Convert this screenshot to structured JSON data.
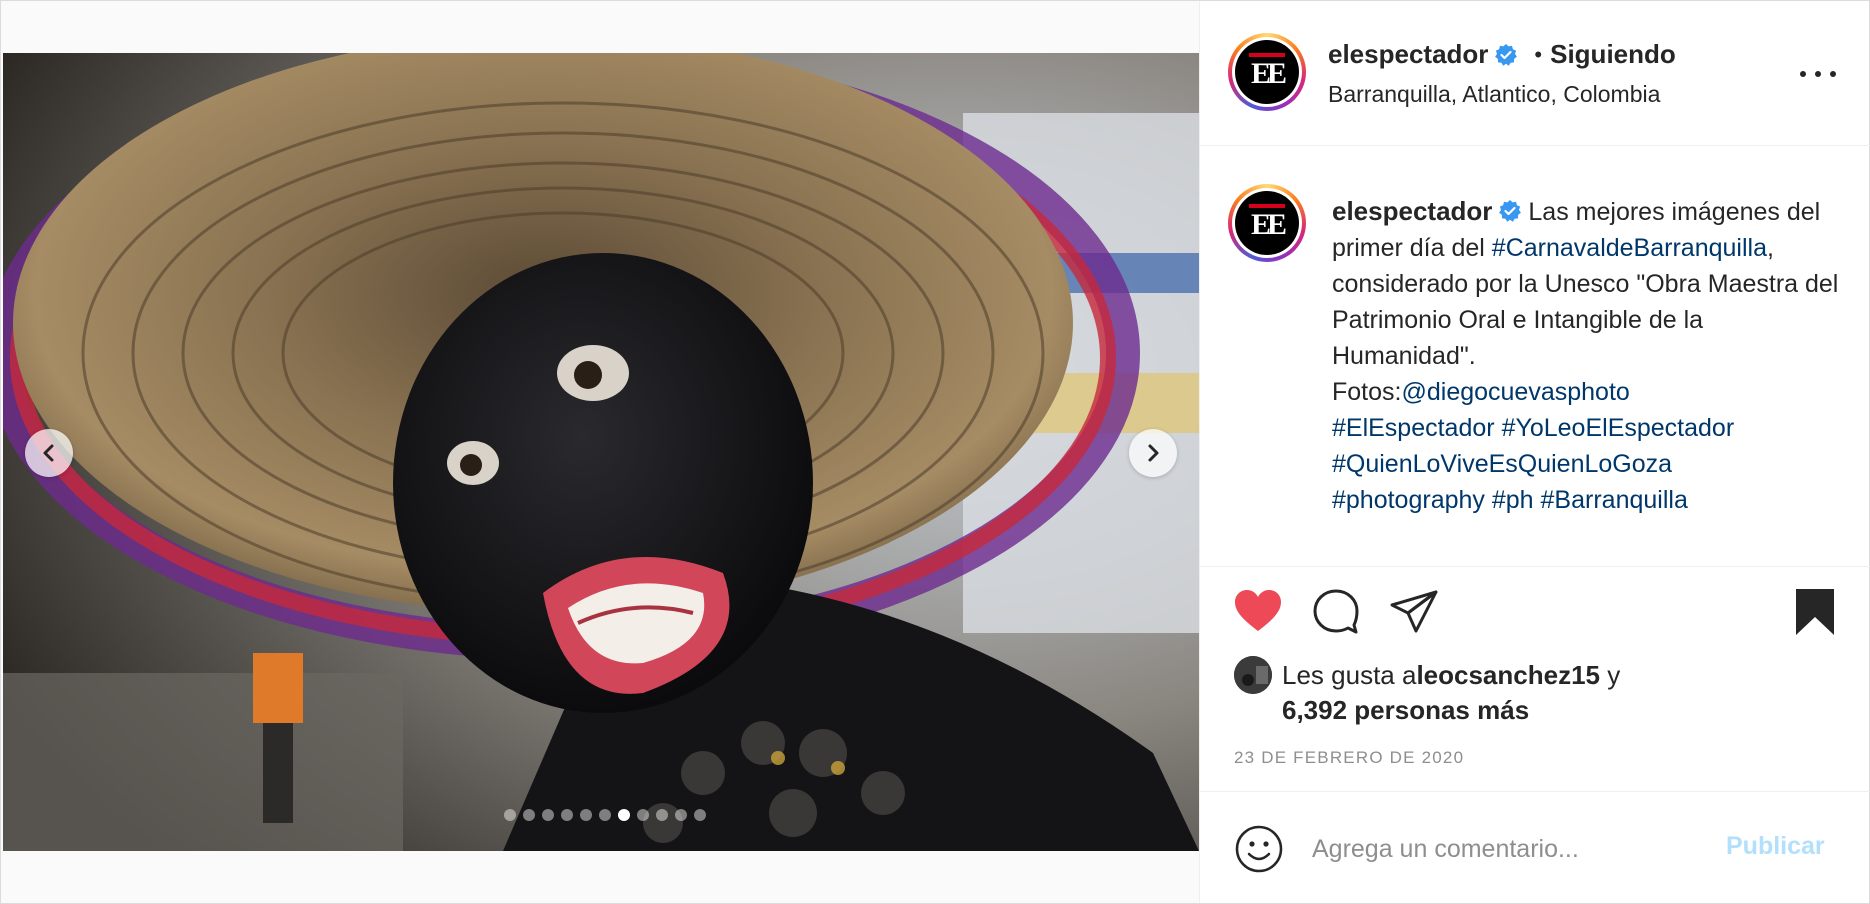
{
  "post": {
    "username": "elespectador",
    "follow_status": "Siguiendo",
    "separator": "•",
    "location": "Barranquilla, Atlantico, Colombia",
    "avatar_logo": "EE",
    "caption": {
      "part1": "Las mejores imágenes del primer día del ",
      "hashtag_carnaval": "#CarnavaldeBarranquilla",
      "part2": ", considerado por la Unesco \"Obra Maestra del Patrimonio Oral e Intangible de la Humanidad\".",
      "fotos_label": "Fotos:",
      "mention": "@diegocuevasphoto",
      "hashtags": [
        "#ElEspectador",
        "#YoLeoElEspectador",
        "#QuienLoViveEsQuienLoGoza",
        "#photography",
        "#ph",
        "#Barranquilla"
      ]
    },
    "likes": {
      "prefix": "Les gusta a ",
      "user": "leocsanchez15",
      "conj": " y",
      "others": "6,392 personas más"
    },
    "date": "23 DE FEBRERO DE 2020",
    "comment": {
      "placeholder": "Agrega un comentario...",
      "publish_label": "Publicar"
    },
    "carousel": {
      "total": 11,
      "active_index": 6
    }
  },
  "colors": {
    "like_red": "#ed4956",
    "link_blue": "#00376b",
    "verified_blue": "#3897f0",
    "publish_disabled": "#b2dffc"
  },
  "icons": [
    "chevron-left-icon",
    "chevron-right-icon",
    "heart-filled-icon",
    "comment-icon",
    "share-icon",
    "bookmark-filled-icon",
    "more-icon",
    "verified-icon",
    "emoji-icon"
  ]
}
